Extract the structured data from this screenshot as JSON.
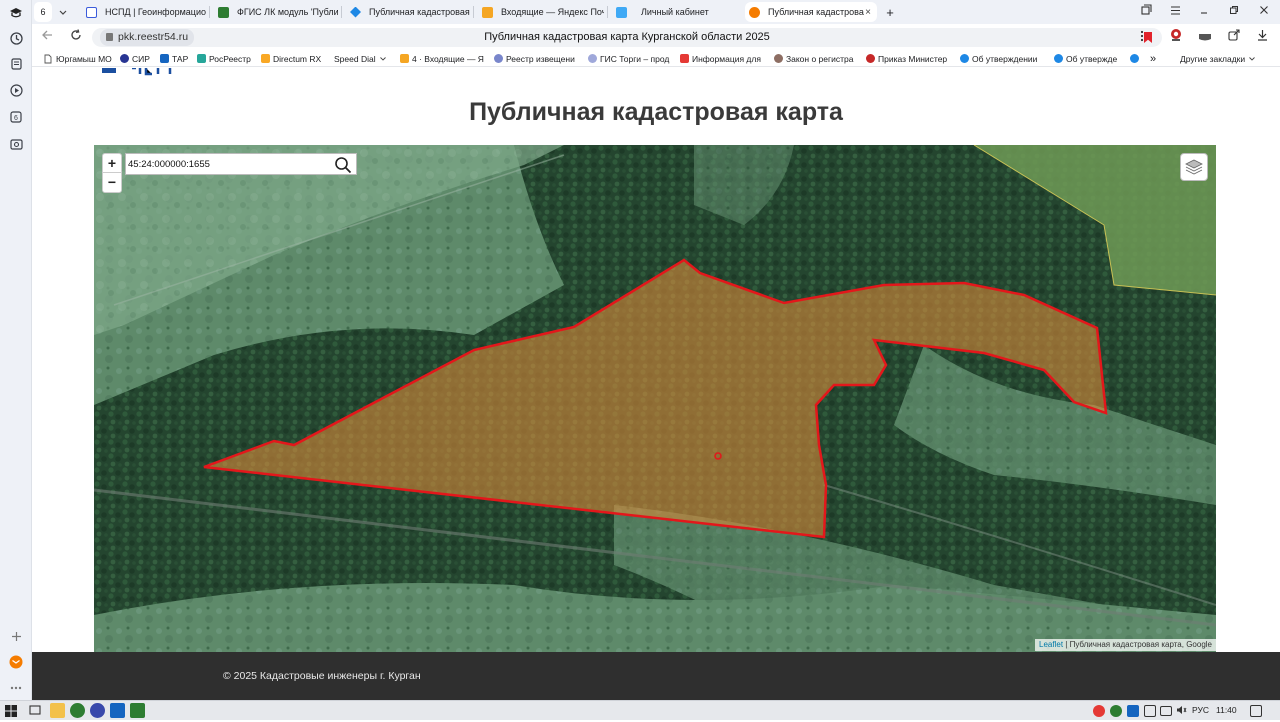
{
  "browser": {
    "tab_count": "6",
    "tabs": [
      {
        "label": "НСПД | Геоинформацион",
        "color": "#3b5bdb"
      },
      {
        "label": "ФГИС ЛК модуль 'Публи",
        "color": "#2e7d32"
      },
      {
        "label": "Публичная кадастровая",
        "color": "#1e88e5"
      },
      {
        "label": "Входящие — Яндекс Почт",
        "color": "#f5a623"
      },
      {
        "label": "Личный кабинет",
        "color": "#3fa9f5"
      },
      {
        "label": "Публичная кадастрова",
        "color": "#f57c00",
        "close": "×"
      }
    ],
    "new_tab": "+",
    "url": "pkk.reestr54.ru",
    "page_title": "Публичная кадастровая карта Курганской области 2025",
    "bookmarks": [
      {
        "label": "Юргамыш МО",
        "color": "#5c6bc0"
      },
      {
        "label": "СИР",
        "color": "#283593"
      },
      {
        "label": "ТАР",
        "color": "#1565c0"
      },
      {
        "label": "РосРеестр",
        "color": "#26a69a"
      },
      {
        "label": "Directum RX",
        "color": "#f9a825"
      },
      {
        "label": "Speed Dial",
        "color": "#ffffff"
      },
      {
        "label": "4 · Входящие — Я",
        "color": "#f5a623"
      },
      {
        "label": "Реестр извещени",
        "color": "#7986cb"
      },
      {
        "label": "ГИС Торги – прод",
        "color": "#9fa8da"
      },
      {
        "label": "Информация для",
        "color": "#e53935"
      },
      {
        "label": "Закон о регистра",
        "color": "#8d6e63"
      },
      {
        "label": "Приказ Министер",
        "color": "#c62828"
      },
      {
        "label": "Об утверждении",
        "color": "#1e88e5"
      },
      {
        "label": "Об утвержде",
        "color": "#1e88e5"
      }
    ],
    "more_bookmarks": "»",
    "other_bookmarks": "Другие закладки"
  },
  "page": {
    "heading": "Публичная кадастровая карта",
    "search_value": "45:24:000000:1655",
    "zoom_in": "+",
    "zoom_out": "−",
    "attribution_leaflet": "Leaflet",
    "attribution_rest": " | Публичная кадастровая карта, Google",
    "footer_text": "© 2025 Кадастровые инженеры г. Курган"
  },
  "taskbar": {
    "language": "РУС",
    "time": "11:40"
  },
  "colors": {
    "parcel_outline": "#e3171b",
    "parcel_fill": "#d98a3a",
    "footer_bg": "#2f2f2f"
  }
}
